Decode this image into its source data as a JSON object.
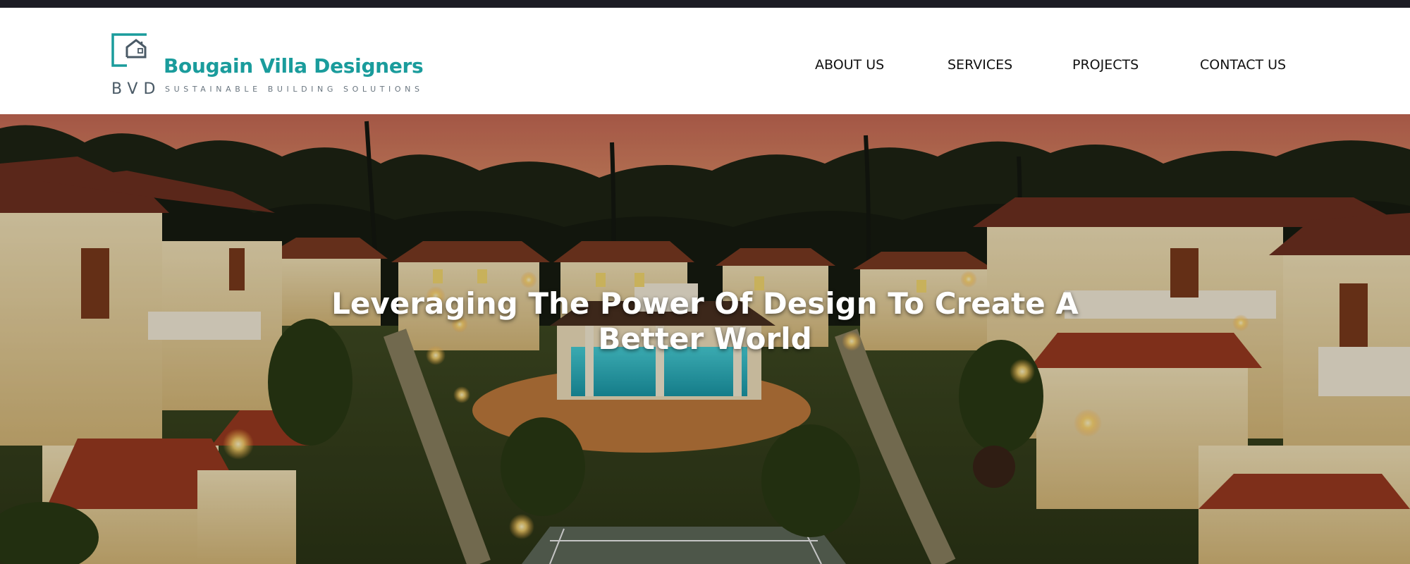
{
  "brand": {
    "name": "Bougain Villa Designers",
    "initials": "BVD",
    "tagline": "SUSTAINABLE BUILDING SOLUTIONS",
    "colors": {
      "primary": "#1a9c9c",
      "secondary": "#4a5a66"
    }
  },
  "nav": {
    "items": [
      {
        "label": "ABOUT US"
      },
      {
        "label": "SERVICES"
      },
      {
        "label": "PROJECTS"
      },
      {
        "label": "CONTACT US"
      }
    ]
  },
  "hero": {
    "heading_line1": "Leveraging The Power Of Design To Create A",
    "heading_line2": "Better World",
    "image_subject": "resort villas around a swimming pool at dusk"
  },
  "icons": {
    "logo_mark": "house-in-frame-icon"
  }
}
